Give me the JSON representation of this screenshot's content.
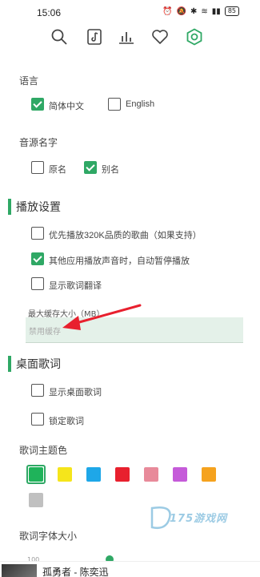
{
  "status": {
    "time": "15:06",
    "battery": "85"
  },
  "nav": {
    "icons": [
      "search-icon",
      "music-file-icon",
      "chart-icon",
      "heart-icon",
      "settings-icon"
    ]
  },
  "language": {
    "title": "语言",
    "options": [
      {
        "label": "简体中文",
        "checked": true
      },
      {
        "label": "English",
        "checked": false
      }
    ]
  },
  "source_name": {
    "title": "音源名字",
    "options": [
      {
        "label": "原名",
        "checked": false
      },
      {
        "label": "别名",
        "checked": true
      }
    ]
  },
  "playback": {
    "title": "播放设置",
    "options": [
      {
        "label": "优先播放320K品质的歌曲（如果支持）",
        "checked": false
      },
      {
        "label": "其他应用播放声音时，自动暂停播放",
        "checked": true
      },
      {
        "label": "显示歌词翻译",
        "checked": false
      }
    ],
    "cache_label": "最大缓存大小（MB）",
    "cache_placeholder": "禁用缓存"
  },
  "desktop_lyrics": {
    "title": "桌面歌词",
    "options": [
      {
        "label": "显示桌面歌词",
        "checked": false
      },
      {
        "label": "锁定歌词",
        "checked": false
      }
    ],
    "theme_color_label": "歌词主题色",
    "colors": [
      "#1fb35a",
      "#f5e51b",
      "#1ea7e8",
      "#e8202e",
      "#e88a9a",
      "#c55bd9",
      "#f5a21e",
      "#c0c0c0"
    ],
    "font_size_label": "歌词字体大小",
    "slider_min": "100"
  },
  "player": {
    "title": "孤勇者 - 陈奕迅"
  },
  "watermark": {
    "text": "175游戏网"
  },
  "colors": {
    "accent": "#2fa865"
  }
}
